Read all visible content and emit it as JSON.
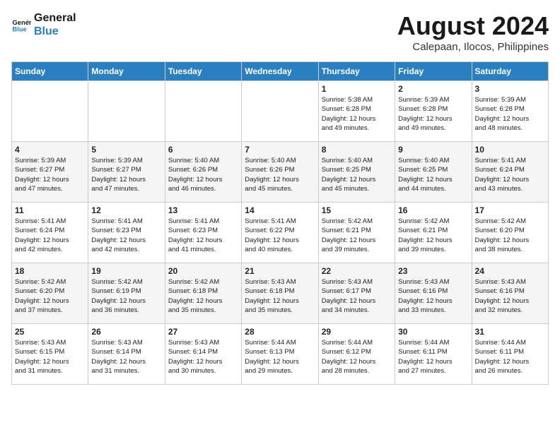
{
  "logo": {
    "line1": "General",
    "line2": "Blue"
  },
  "title": "August 2024",
  "subtitle": "Calepaan, Ilocos, Philippines",
  "days_of_week": [
    "Sunday",
    "Monday",
    "Tuesday",
    "Wednesday",
    "Thursday",
    "Friday",
    "Saturday"
  ],
  "weeks": [
    [
      {
        "day": "",
        "info": ""
      },
      {
        "day": "",
        "info": ""
      },
      {
        "day": "",
        "info": ""
      },
      {
        "day": "",
        "info": ""
      },
      {
        "day": "1",
        "info": "Sunrise: 5:38 AM\nSunset: 6:28 PM\nDaylight: 12 hours\nand 49 minutes."
      },
      {
        "day": "2",
        "info": "Sunrise: 5:39 AM\nSunset: 6:28 PM\nDaylight: 12 hours\nand 49 minutes."
      },
      {
        "day": "3",
        "info": "Sunrise: 5:39 AM\nSunset: 6:28 PM\nDaylight: 12 hours\nand 48 minutes."
      }
    ],
    [
      {
        "day": "4",
        "info": "Sunrise: 5:39 AM\nSunset: 6:27 PM\nDaylight: 12 hours\nand 47 minutes."
      },
      {
        "day": "5",
        "info": "Sunrise: 5:39 AM\nSunset: 6:27 PM\nDaylight: 12 hours\nand 47 minutes."
      },
      {
        "day": "6",
        "info": "Sunrise: 5:40 AM\nSunset: 6:26 PM\nDaylight: 12 hours\nand 46 minutes."
      },
      {
        "day": "7",
        "info": "Sunrise: 5:40 AM\nSunset: 6:26 PM\nDaylight: 12 hours\nand 45 minutes."
      },
      {
        "day": "8",
        "info": "Sunrise: 5:40 AM\nSunset: 6:25 PM\nDaylight: 12 hours\nand 45 minutes."
      },
      {
        "day": "9",
        "info": "Sunrise: 5:40 AM\nSunset: 6:25 PM\nDaylight: 12 hours\nand 44 minutes."
      },
      {
        "day": "10",
        "info": "Sunrise: 5:41 AM\nSunset: 6:24 PM\nDaylight: 12 hours\nand 43 minutes."
      }
    ],
    [
      {
        "day": "11",
        "info": "Sunrise: 5:41 AM\nSunset: 6:24 PM\nDaylight: 12 hours\nand 42 minutes."
      },
      {
        "day": "12",
        "info": "Sunrise: 5:41 AM\nSunset: 6:23 PM\nDaylight: 12 hours\nand 42 minutes."
      },
      {
        "day": "13",
        "info": "Sunrise: 5:41 AM\nSunset: 6:23 PM\nDaylight: 12 hours\nand 41 minutes."
      },
      {
        "day": "14",
        "info": "Sunrise: 5:41 AM\nSunset: 6:22 PM\nDaylight: 12 hours\nand 40 minutes."
      },
      {
        "day": "15",
        "info": "Sunrise: 5:42 AM\nSunset: 6:21 PM\nDaylight: 12 hours\nand 39 minutes."
      },
      {
        "day": "16",
        "info": "Sunrise: 5:42 AM\nSunset: 6:21 PM\nDaylight: 12 hours\nand 39 minutes."
      },
      {
        "day": "17",
        "info": "Sunrise: 5:42 AM\nSunset: 6:20 PM\nDaylight: 12 hours\nand 38 minutes."
      }
    ],
    [
      {
        "day": "18",
        "info": "Sunrise: 5:42 AM\nSunset: 6:20 PM\nDaylight: 12 hours\nand 37 minutes."
      },
      {
        "day": "19",
        "info": "Sunrise: 5:42 AM\nSunset: 6:19 PM\nDaylight: 12 hours\nand 36 minutes."
      },
      {
        "day": "20",
        "info": "Sunrise: 5:42 AM\nSunset: 6:18 PM\nDaylight: 12 hours\nand 35 minutes."
      },
      {
        "day": "21",
        "info": "Sunrise: 5:43 AM\nSunset: 6:18 PM\nDaylight: 12 hours\nand 35 minutes."
      },
      {
        "day": "22",
        "info": "Sunrise: 5:43 AM\nSunset: 6:17 PM\nDaylight: 12 hours\nand 34 minutes."
      },
      {
        "day": "23",
        "info": "Sunrise: 5:43 AM\nSunset: 6:16 PM\nDaylight: 12 hours\nand 33 minutes."
      },
      {
        "day": "24",
        "info": "Sunrise: 5:43 AM\nSunset: 6:16 PM\nDaylight: 12 hours\nand 32 minutes."
      }
    ],
    [
      {
        "day": "25",
        "info": "Sunrise: 5:43 AM\nSunset: 6:15 PM\nDaylight: 12 hours\nand 31 minutes."
      },
      {
        "day": "26",
        "info": "Sunrise: 5:43 AM\nSunset: 6:14 PM\nDaylight: 12 hours\nand 31 minutes."
      },
      {
        "day": "27",
        "info": "Sunrise: 5:43 AM\nSunset: 6:14 PM\nDaylight: 12 hours\nand 30 minutes."
      },
      {
        "day": "28",
        "info": "Sunrise: 5:44 AM\nSunset: 6:13 PM\nDaylight: 12 hours\nand 29 minutes."
      },
      {
        "day": "29",
        "info": "Sunrise: 5:44 AM\nSunset: 6:12 PM\nDaylight: 12 hours\nand 28 minutes."
      },
      {
        "day": "30",
        "info": "Sunrise: 5:44 AM\nSunset: 6:11 PM\nDaylight: 12 hours\nand 27 minutes."
      },
      {
        "day": "31",
        "info": "Sunrise: 5:44 AM\nSunset: 6:11 PM\nDaylight: 12 hours\nand 26 minutes."
      }
    ]
  ]
}
